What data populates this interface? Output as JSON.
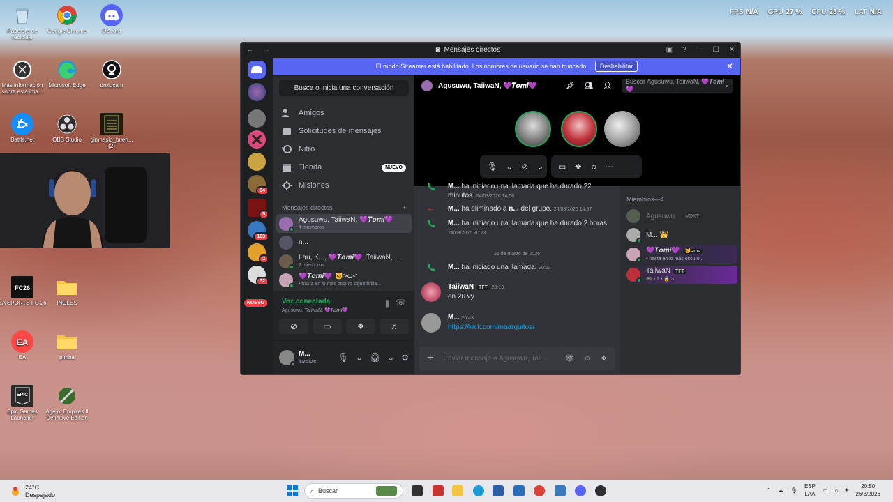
{
  "hud": {
    "fps_label": "FPS",
    "fps": "N/A",
    "gpu_label": "GPU",
    "gpu": "27 %",
    "cpu_label": "CPU",
    "cpu": "28 %",
    "lat_label": "LAT",
    "lat": "N/A"
  },
  "desktop_icons": [
    {
      "label": "Papelera de reciclaje"
    },
    {
      "label": "Google Chrome"
    },
    {
      "label": "Discord"
    },
    {
      "label": "Más información sobre esta ima..."
    },
    {
      "label": "Microsoft Edge"
    },
    {
      "label": "droidcam"
    },
    {
      "label": "Battle.net"
    },
    {
      "label": "OBS Studio"
    },
    {
      "label": "gimnasio_buen... (2)"
    },
    {
      "label": "EA SPORTS FC 26"
    },
    {
      "label": "INGLES"
    },
    {
      "label": "EA"
    },
    {
      "label": "pimba"
    },
    {
      "label": "Epic Games Launcher"
    },
    {
      "label": "Age of Empires II Definitive Edition"
    }
  ],
  "window": {
    "title": "Mensajes directos"
  },
  "banner": {
    "text": "El modo Streamer está habilitado. Los nombres de usuario se han truncado.",
    "button": "Deshabilitar"
  },
  "server_badges": [
    "64",
    "5",
    "163",
    "2",
    "52"
  ],
  "server_new": "NUEVO",
  "dm": {
    "search": "Busca o inicia una conversación",
    "nav": [
      {
        "label": "Amigos",
        "icon": "friends-icon"
      },
      {
        "label": "Solicitudes de mensajes",
        "icon": "mail-icon"
      },
      {
        "label": "Nitro",
        "icon": "nitro-icon"
      },
      {
        "label": "Tienda",
        "icon": "shop-icon",
        "badge": "NUEVO"
      },
      {
        "label": "Misiones",
        "icon": "quests-icon"
      }
    ],
    "section": "Mensajes directos",
    "items": [
      {
        "name": "Agusuwu, TaiiwaN, 💜𝑻𝒐𝒎𝒊💜",
        "sub": "4 miembros"
      },
      {
        "name": "n...",
        "sub": ""
      },
      {
        "name": "Lau, K..., 💜𝑻𝒐𝒎𝒊💜, TaiiwaN, ...",
        "sub": "7 miembros"
      },
      {
        "name": "💜𝑻𝒐𝒎𝒊💜 🐱>ω<",
        "sub": "• hasta en lo más oscuro sigue brilla..."
      }
    ]
  },
  "voice": {
    "status": "Voz conectada",
    "channel": "Agusuwu, TaiiwaN, 💜𝑻𝒐𝒎𝒊💜"
  },
  "user": {
    "name": "M...",
    "status": "Invisible"
  },
  "call": {
    "title": "Agusuwu, TaiiwaN, 💜𝑻𝒐𝒎𝒊💜",
    "search_placeholder": "Buscar Agusuwu, TaiiwaN, 💜𝑻𝒐𝒎𝒊💜"
  },
  "chat": {
    "m1_name": "M...",
    "m1_text": "ha iniciado una llamada que ha durado 22 minutos.",
    "m1_ts": "24/03/2026 14:56",
    "m2_name": "M...",
    "m2_text": "ha eliminado a",
    "m2_target": "n...",
    "m2_text2": "del grupo.",
    "m2_ts": "24/03/2026 14:57",
    "m3_name": "M...",
    "m3_text": "ha iniciado una llamada que ha durado 2 horas.",
    "m3_ts": "24/03/2026 20:23",
    "date": "26 de marzo de 2026",
    "m4_name": "M...",
    "m4_text": "ha iniciado una llamada.",
    "m4_ts": "20:13",
    "m5_name": "TaiiwaN",
    "m5_tag": "TFT",
    "m5_ts": "20:13",
    "m5_text": "en 20 vy",
    "m6_name": "M...",
    "m6_ts": "20:43",
    "m6_link": "https://kick.com/maarquitosr",
    "input_placeholder": "Enviar mensaje a Agusuwu, Taii..."
  },
  "members": {
    "header": "Miembros—4",
    "list": [
      {
        "name": "Agusuwu",
        "tag": "MDKT",
        "sub": ""
      },
      {
        "name": "M... 👑",
        "tag": "",
        "sub": ""
      },
      {
        "name": "💜𝑻𝒐𝒎𝒊💜",
        "tag": "🐱>ω<",
        "sub": "• hasta en lo más oscuro..."
      },
      {
        "name": "TaiiwaN",
        "tag": "TFT",
        "sub": "🎮 • 1 • 🔒 3"
      }
    ]
  },
  "taskbar": {
    "temp": "24°C",
    "weather": "Despejado",
    "search": "Buscar",
    "lang1": "ESP",
    "lang2": "LAA",
    "time": "20:50",
    "date": "26/3/2026"
  },
  "colors": {
    "accent": "#5865f2",
    "online": "#23a55a",
    "danger": "#da373c"
  }
}
